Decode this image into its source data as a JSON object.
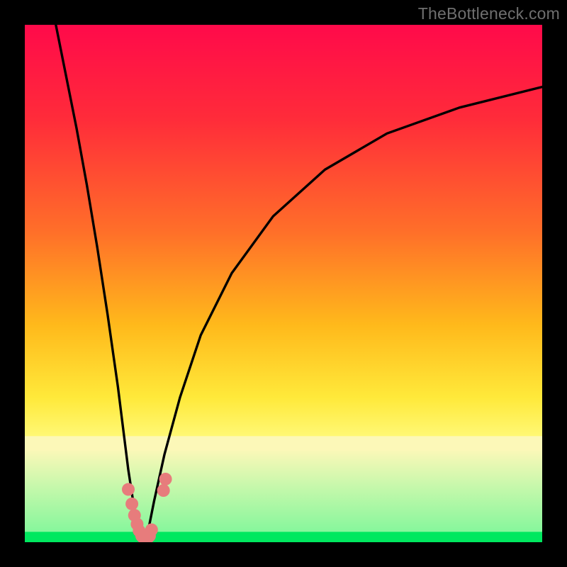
{
  "brand": "TheBottleneck.com",
  "colors": {
    "black": "#000000",
    "curve": "#000000",
    "marker": "#e77c7c",
    "bottom_green": "#00e85f",
    "pale_yellow": "#fcf8b8"
  },
  "chart_data": {
    "type": "line",
    "title": "",
    "xlabel": "",
    "ylabel": "",
    "xlim": [
      0,
      100
    ],
    "ylim": [
      0,
      100
    ],
    "legend": false,
    "grid": false,
    "background_gradient": {
      "stops": [
        {
          "pos": 0.0,
          "color": "#ff0a4a"
        },
        {
          "pos": 0.18,
          "color": "#ff2b3a"
        },
        {
          "pos": 0.4,
          "color": "#ff6f29"
        },
        {
          "pos": 0.58,
          "color": "#ffb91b"
        },
        {
          "pos": 0.72,
          "color": "#ffe93a"
        },
        {
          "pos": 0.8,
          "color": "#fff978"
        },
        {
          "pos": 0.82,
          "color": "#fcf8b8"
        },
        {
          "pos": 0.98,
          "color": "#86f79c"
        },
        {
          "pos": 1.0,
          "color": "#00e85f"
        }
      ]
    },
    "series": [
      {
        "name": "left-branch",
        "x": [
          6,
          8,
          10,
          12,
          14,
          16,
          18,
          19,
          20,
          21,
          21.5,
          22,
          22.5,
          23
        ],
        "y": [
          100,
          90,
          80,
          69,
          57,
          44,
          30,
          22,
          14,
          7.5,
          4.5,
          2.2,
          0.8,
          0
        ]
      },
      {
        "name": "right-branch",
        "x": [
          23,
          24,
          25,
          27,
          30,
          34,
          40,
          48,
          58,
          70,
          84,
          100
        ],
        "y": [
          0,
          3,
          8,
          17,
          28,
          40,
          52,
          63,
          72,
          79,
          84,
          88
        ]
      }
    ],
    "markers": [
      {
        "x": 20.0,
        "y": 10.2
      },
      {
        "x": 20.7,
        "y": 7.4
      },
      {
        "x": 21.2,
        "y": 5.2
      },
      {
        "x": 21.7,
        "y": 3.5
      },
      {
        "x": 22.1,
        "y": 2.2
      },
      {
        "x": 22.6,
        "y": 1.2
      },
      {
        "x": 23.1,
        "y": 0.6
      },
      {
        "x": 23.6,
        "y": 0.6
      },
      {
        "x": 24.1,
        "y": 1.2
      },
      {
        "x": 24.5,
        "y": 2.4
      },
      {
        "x": 26.8,
        "y": 10.0
      },
      {
        "x": 27.2,
        "y": 12.2
      }
    ],
    "marker_radius_px": 9
  }
}
